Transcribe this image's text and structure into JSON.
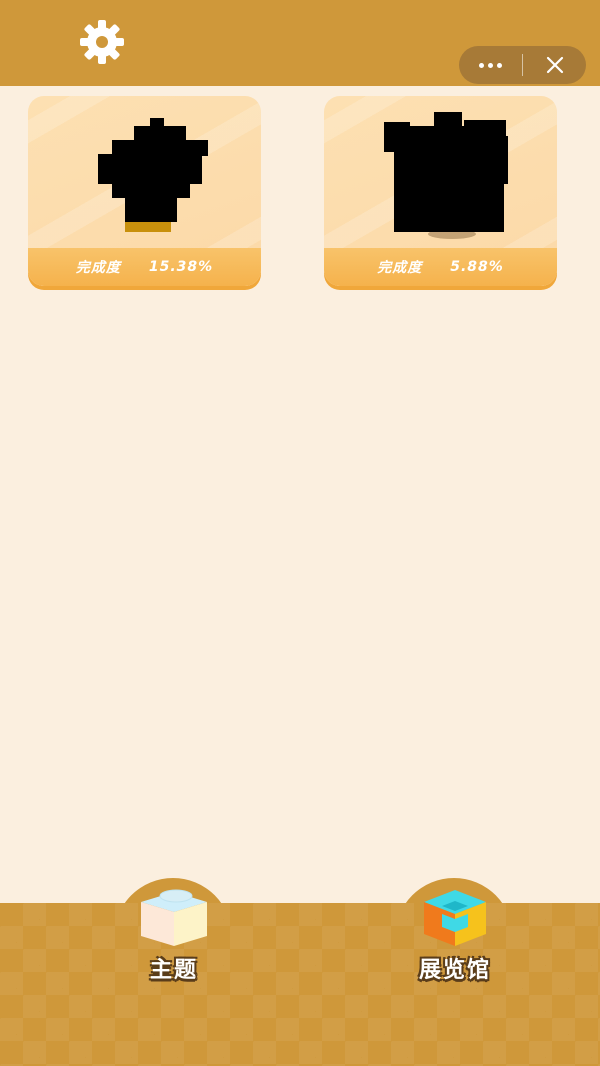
{
  "header": {
    "settings_icon": "gear-icon",
    "menu_more_icon": "more-dots-icon",
    "menu_close_icon": "close-icon"
  },
  "cards": [
    {
      "progress_label": "完成度",
      "progress_value": "15.38%",
      "thumbnail": "silhouette-vase"
    },
    {
      "progress_label": "完成度",
      "progress_value": "5.88%",
      "thumbnail": "silhouette-house"
    }
  ],
  "tabbar": {
    "items": [
      {
        "label": "主题",
        "icon": "block-icon"
      },
      {
        "label": "展览馆",
        "icon": "cube-icon"
      }
    ]
  },
  "colors": {
    "bar": "#cf983a",
    "background": "#fbefdf",
    "card_footer": "#f5b24c"
  }
}
